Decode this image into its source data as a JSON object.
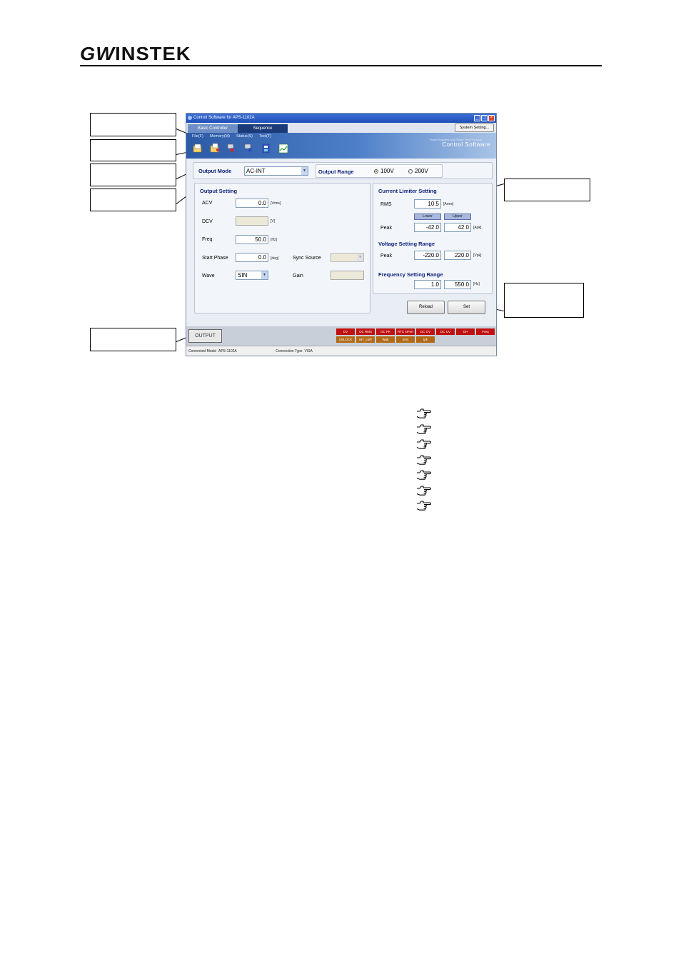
{
  "logo": {
    "text": "INSTEK",
    "gw": "GW"
  },
  "window": {
    "title": "Control Software for APS-1102A",
    "tabs": [
      "Basic Controller",
      "Sequence"
    ],
    "system_setting": "System Setting...",
    "menu": [
      "File(F)",
      "Memory(M)",
      "Status(S)",
      "Tool(T)"
    ],
    "brand_small": "Power Supplies and Power Test Products",
    "brand": "Control Software",
    "toolbar_icons": [
      "open-icon",
      "save-icon",
      "download-icon",
      "upload-icon",
      "settings-icon",
      "chart-icon"
    ],
    "output_mode": {
      "label": "Output Mode",
      "value": "AC-INT"
    },
    "output_range": {
      "label": "Output Range",
      "option1": "100V",
      "option2": "200V",
      "selected": "100V"
    },
    "output_setting": {
      "title": "Output Setting",
      "acv_label": "ACV",
      "acv_value": "0.0",
      "acv_unit": "[Vrms]",
      "dcv_label": "DCV",
      "dcv_value": "",
      "dcv_unit": "[V]",
      "freq_label": "Freq",
      "freq_value": "50.0",
      "freq_unit": "[Hz]",
      "phase_label": "Start Phase",
      "phase_value": "0.0",
      "phase_unit": "[deg]",
      "sync_label": "Sync Source",
      "sync_value": "",
      "wave_label": "Wave",
      "wave_value": "SIN",
      "gain_label": "Gain",
      "gain_value": ""
    },
    "current_limiter": {
      "title": "Current Limiter Setting",
      "rms_label": "RMS",
      "rms_value": "10.5",
      "rms_unit": "[Arms]",
      "lower": "Lower",
      "upper": "Upper",
      "peak_label": "Peak",
      "peak_lower": "-42.0",
      "peak_upper": "42.0",
      "peak_unit": "[Apk]"
    },
    "voltage_range": {
      "title": "Voltage Setting Range",
      "peak_label": "Peak",
      "lower": "-220.0",
      "upper": "220.0",
      "unit": "[Vpk]"
    },
    "frequency_range": {
      "title": "Frequency Setting Range",
      "lower": "1.0",
      "upper": "550.0",
      "unit": "[Hz]"
    },
    "reload": "Reload",
    "set": "Set",
    "output_button": "OUTPUT",
    "indicators_row1": [
      "OV",
      "OC RMS",
      "OC PK",
      "RTC NFerr",
      "DC OV",
      "DC UV",
      "OH",
      "Freq"
    ],
    "indicators_row2": [
      "UNLOCK",
      "INT_LMT",
      "Watt",
      "Irms",
      "Ipk"
    ],
    "status": {
      "model_label": "Connected Model",
      "model": "APS-1102A",
      "conn_label": "Connection Type",
      "conn": "VISA"
    },
    "colors": {
      "accent": "#10237a",
      "indicator_red": "#c01010",
      "indicator_orange": "#b36a16"
    }
  },
  "reference_icons": [
    "pointing-hand-icon",
    "pointing-hand-icon",
    "pointing-hand-icon",
    "pointing-hand-icon",
    "pointing-hand-icon",
    "pointing-hand-icon",
    "pointing-hand-icon"
  ]
}
